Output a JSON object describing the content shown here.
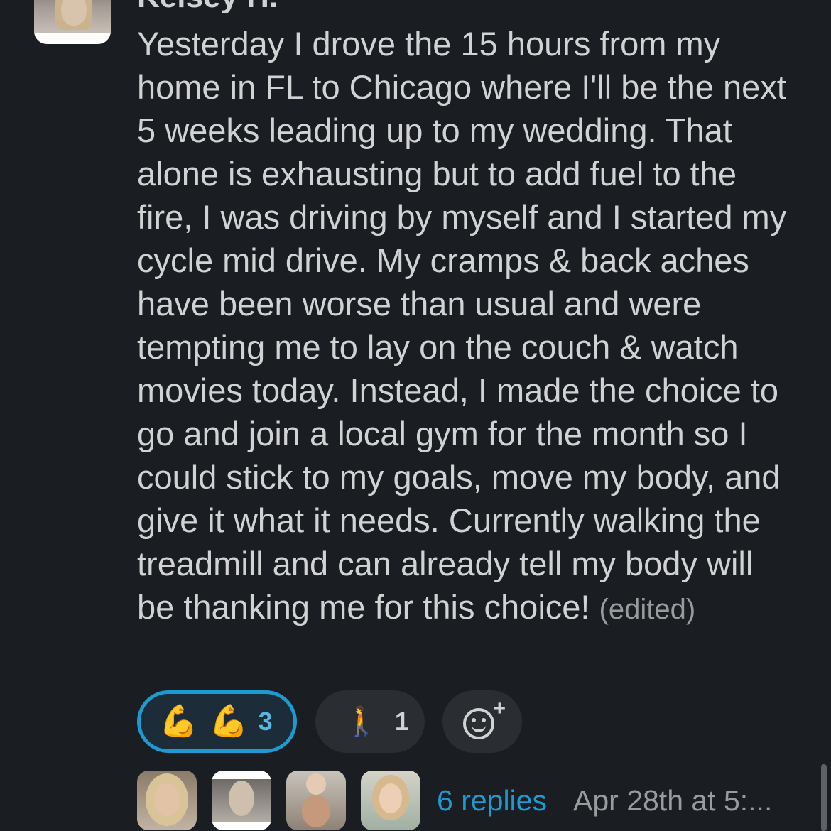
{
  "message": {
    "author": "Kelsey H.",
    "text": "Yesterday I drove the 15 hours from my home in FL to Chicago where I'll be the next 5 weeks leading up to my wedding. That alone is exhausting but to add fuel to the fire, I was driving by myself and I started my cycle mid drive. My cramps & back aches have been worse than usual and were tempting me to lay on the couch & watch movies today. Instead, I made the choice to go and join a local gym for the month so I could stick to my goals, move my body, and give it what it needs. Currently walking the treadmill and can already tell my body will be thanking me for this choice!",
    "edited_label": "(edited)"
  },
  "reactions": [
    {
      "emoji_1": "💪",
      "emoji_2": "💪",
      "icon": "flexed-biceps-icon",
      "count": "3",
      "active": true
    },
    {
      "emoji": "🚶",
      "icon": "person-walking-icon",
      "count": "1",
      "active": false
    }
  ],
  "thread": {
    "replies_label": "6 replies",
    "timestamp": "Apr 28th at 5:..."
  },
  "colors": {
    "background": "#1a1d21",
    "text": "#d1d2d3",
    "accent": "#1d9bd1",
    "muted": "#9a9b9d"
  }
}
